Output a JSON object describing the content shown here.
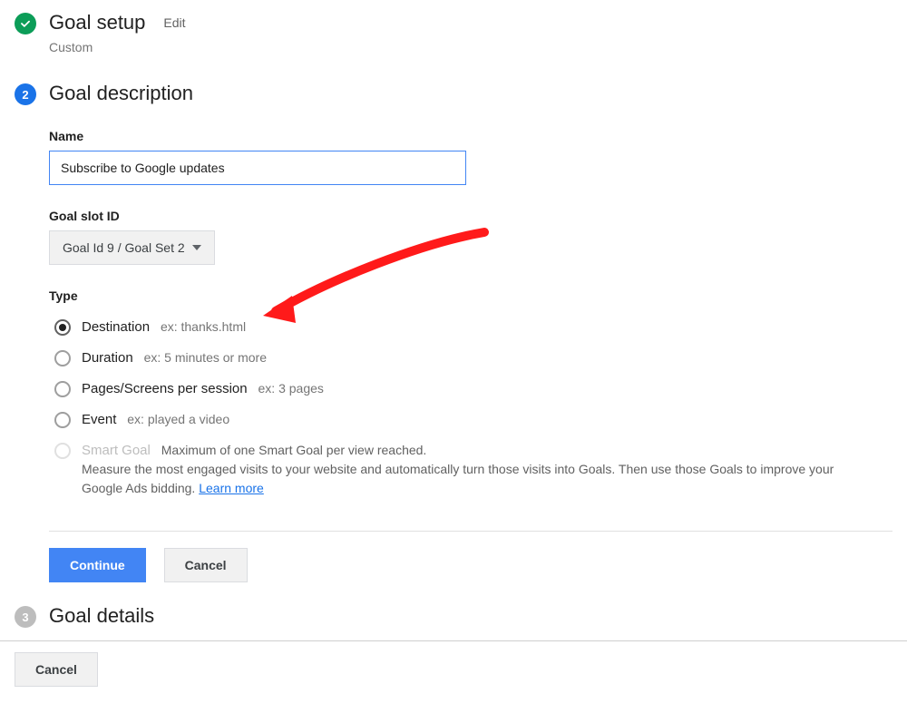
{
  "step1": {
    "title": "Goal setup",
    "edit": "Edit",
    "sub": "Custom"
  },
  "step2": {
    "title": "Goal description",
    "name_label": "Name",
    "name_value": "Subscribe to Google updates",
    "slot_label": "Goal slot ID",
    "slot_value": "Goal Id 9 / Goal Set 2",
    "type_label": "Type",
    "types": {
      "destination": {
        "label": "Destination",
        "ex": "ex: thanks.html"
      },
      "duration": {
        "label": "Duration",
        "ex": "ex: 5 minutes or more"
      },
      "pages": {
        "label": "Pages/Screens per session",
        "ex": "ex: 3 pages"
      },
      "event": {
        "label": "Event",
        "ex": "ex: played a video"
      },
      "smart": {
        "label": "Smart Goal",
        "ex": "Maximum of one Smart Goal per view reached.",
        "desc": "Measure the most engaged visits to your website and automatically turn those visits into Goals. Then use those Goals to improve your Google Ads bidding. ",
        "learn": "Learn more"
      }
    },
    "continue": "Continue",
    "cancel": "Cancel"
  },
  "step3": {
    "title": "Goal details"
  },
  "footer": {
    "cancel": "Cancel"
  }
}
